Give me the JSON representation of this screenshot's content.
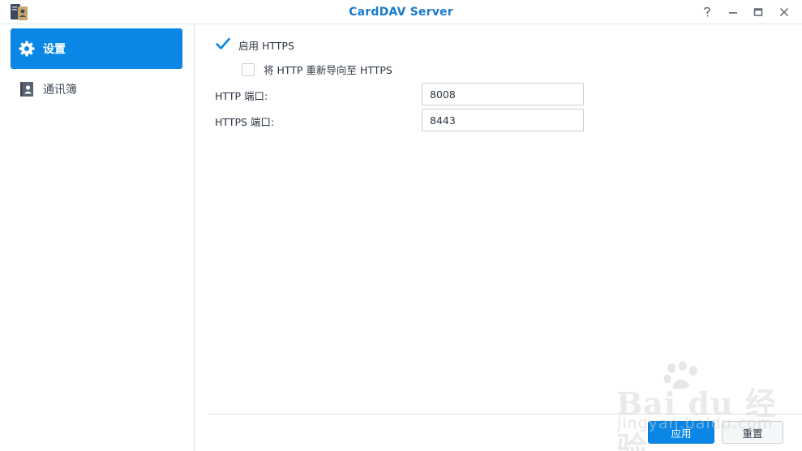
{
  "window": {
    "title": "CardDAV Server"
  },
  "sidebar": {
    "items": [
      {
        "label": "设置",
        "icon": "gear-icon",
        "active": true
      },
      {
        "label": "通讯簿",
        "icon": "address-book-icon",
        "active": false
      }
    ]
  },
  "settings": {
    "enable_https": {
      "label": "启用 HTTPS",
      "checked": true
    },
    "redirect_http": {
      "label": "将 HTTP 重新导向至 HTTPS",
      "checked": false
    },
    "http_port": {
      "label": "HTTP 端口:",
      "value": "8008"
    },
    "https_port": {
      "label": "HTTPS 端口:",
      "value": "8443"
    }
  },
  "footer": {
    "apply_label": "应用",
    "reset_label": "重置"
  },
  "watermark": {
    "line1": "Bai du 经验",
    "line2": "jingyan.baidu.com"
  },
  "colors": {
    "accent": "#0a86e6",
    "title": "#1a7acb"
  }
}
